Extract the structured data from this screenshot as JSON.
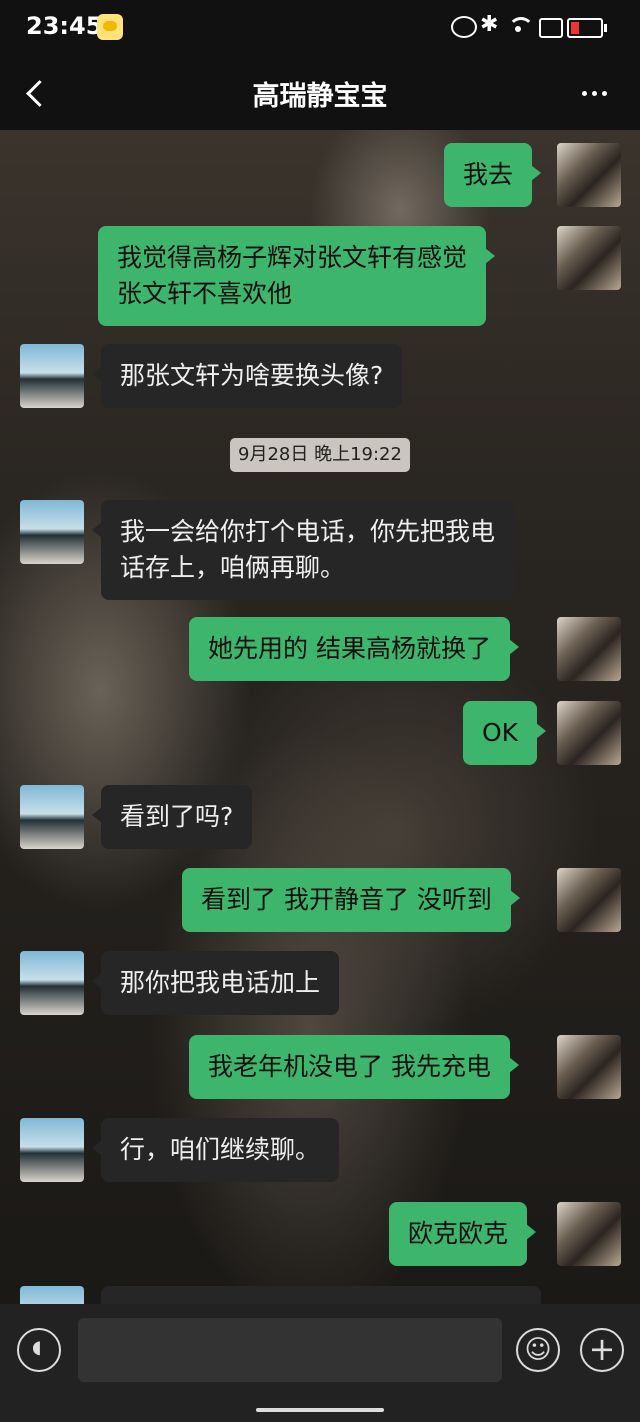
{
  "status_bar": {
    "time": "23:45",
    "bluetooth": "✱"
  },
  "header": {
    "title": "高瑞静宝宝"
  },
  "messages": [
    {
      "dir": "out",
      "text": "我去"
    },
    {
      "dir": "out",
      "text": "我觉得高杨子辉对张文轩有感觉\n张文轩不喜欢他"
    },
    {
      "dir": "in",
      "text": "那张文轩为啥要换头像?"
    },
    {
      "dir": "in",
      "text": "我一会给你打个电话，你先把我电\n话存上，咱俩再聊。"
    },
    {
      "dir": "out",
      "text": "她先用的 结果高杨就换了"
    },
    {
      "dir": "out",
      "text": "OK"
    },
    {
      "dir": "in",
      "text": "看到了吗?"
    },
    {
      "dir": "out",
      "text": "看到了 我开静音了 没听到"
    },
    {
      "dir": "in",
      "text": "那你把我电话加上"
    },
    {
      "dir": "out",
      "text": "我老年机没电了 我先充电"
    },
    {
      "dir": "in",
      "text": "行，咱们继续聊。"
    },
    {
      "dir": "out",
      "text": "欧克欧克"
    }
  ],
  "timestamp": "9月28日 晚上19:22",
  "icons": {
    "back": "back-arrow-icon",
    "more": "more-dots-icon",
    "voice": "voice-input-icon",
    "emoji": "emoji-icon",
    "plus": "plus-icon"
  },
  "colors": {
    "outgoing_bubble": "#3eb56c",
    "incoming_bubble": "#262626",
    "header_bg": "#111111"
  }
}
